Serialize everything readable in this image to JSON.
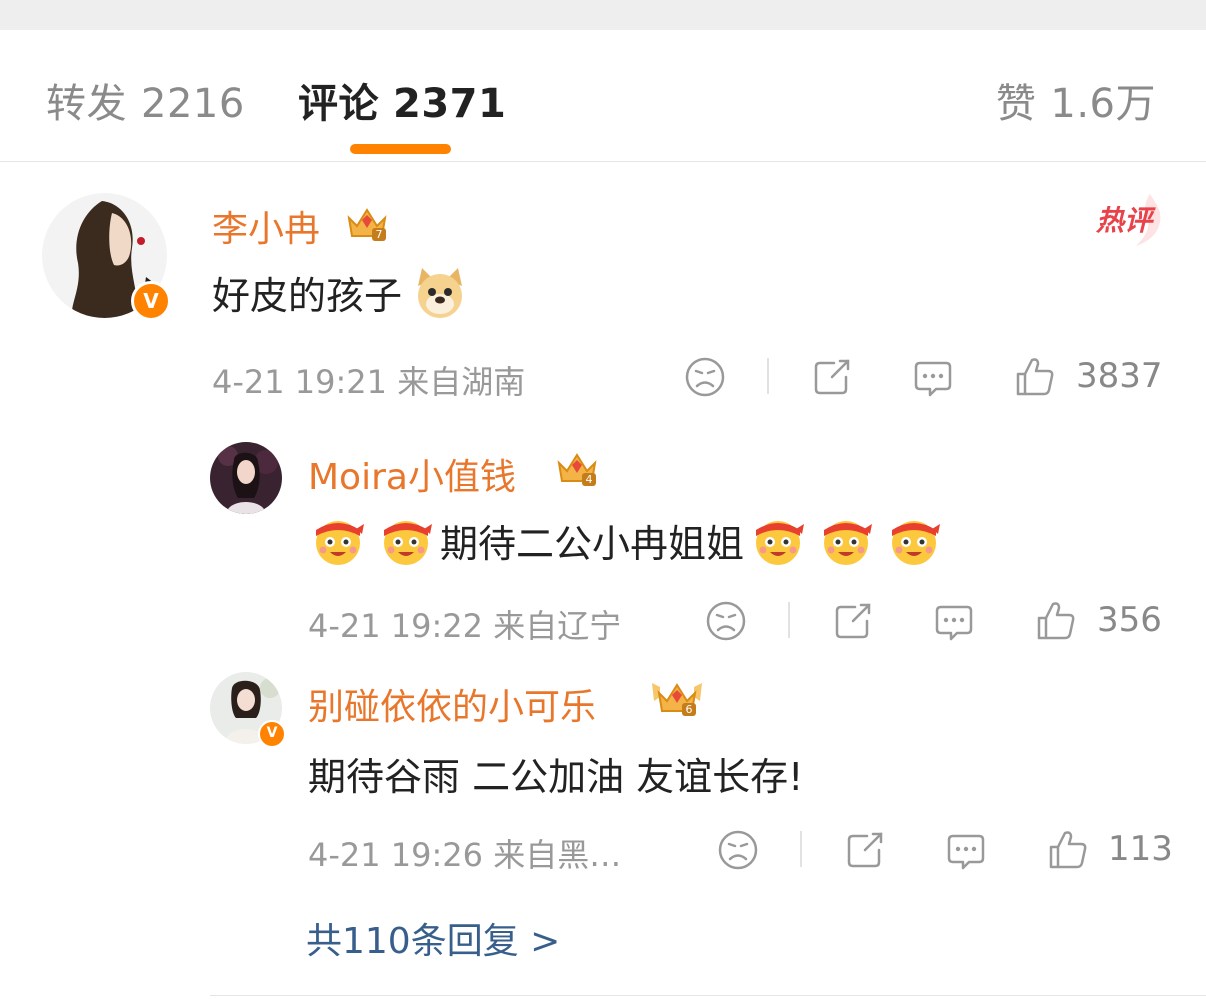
{
  "tabs": {
    "forward": {
      "label": "转发",
      "count": "2216"
    },
    "comments": {
      "label": "评论",
      "count": "2371"
    },
    "likes": {
      "label": "赞",
      "count": "1.6万"
    }
  },
  "hot_label": "热评",
  "comment": {
    "username": "李小冉",
    "crown_level": "7",
    "verified_badge": "V",
    "text": "好皮的孩子",
    "emoji": "doge-emoji",
    "time": "4-21 19:21",
    "location": "来自湖南",
    "likes": "3837"
  },
  "replies": [
    {
      "username": "Moira小值钱",
      "crown_level": "4",
      "text": "期待二公小冉姐姐",
      "emoji": "cheer-emoji",
      "time": "4-21 19:22",
      "location": "来自辽宁",
      "likes": "356"
    },
    {
      "username": "别碰依依的小可乐",
      "crown_level": "6",
      "verified_badge": "V",
      "text": "期待谷雨 二公加油 友谊长存!",
      "time": "4-21 19:26",
      "location": "来自黑…",
      "likes": "113"
    }
  ],
  "more_replies": "共110条回复 >",
  "colors": {
    "accent": "#ff8200",
    "username": "#e8772c",
    "link": "#385f8c",
    "meta": "#999999"
  }
}
